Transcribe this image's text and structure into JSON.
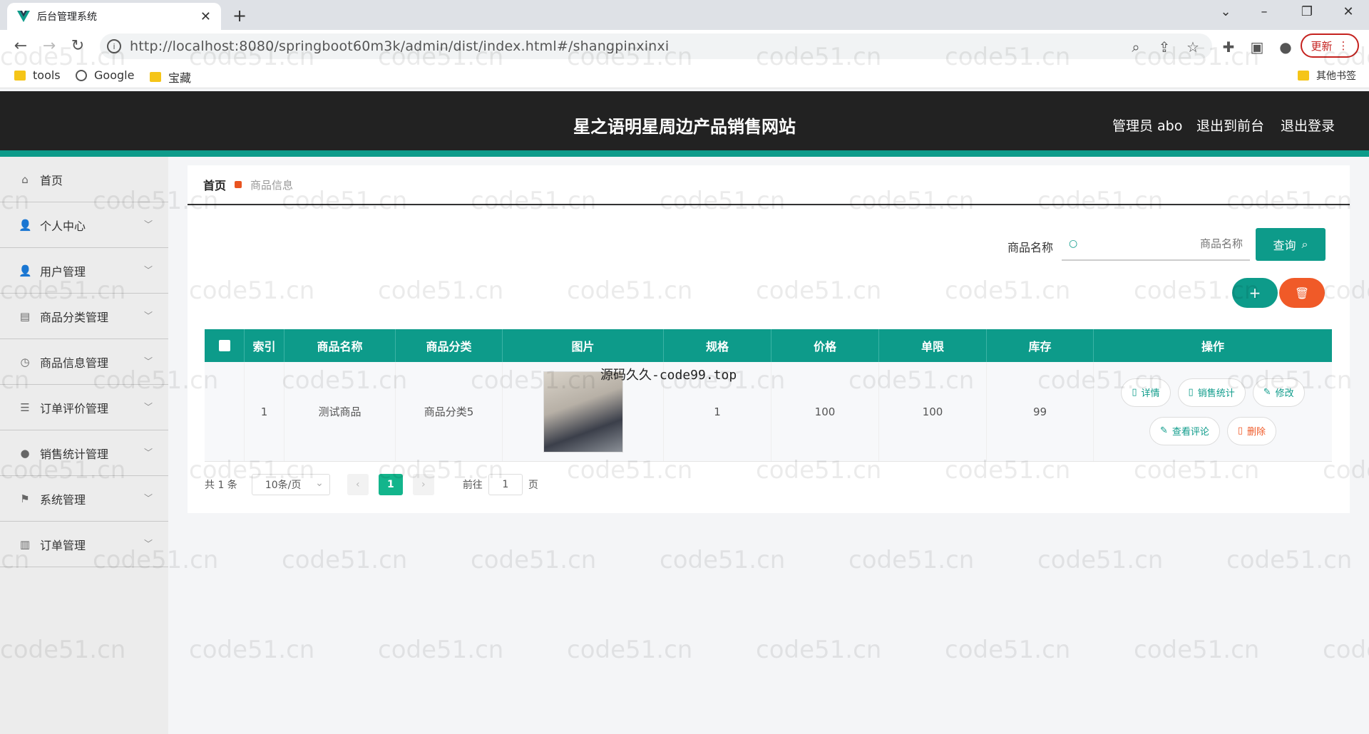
{
  "browser": {
    "tab_title": "后台管理系统",
    "url": "http://localhost:8080/springboot60m3k/admin/dist/index.html#/shangpinxinxi",
    "update_label": "更新",
    "bookmarks": [
      "tools",
      "Google",
      "宝藏"
    ],
    "other_bookmarks": "其他书签"
  },
  "header": {
    "site_title": "星之语明星周边产品销售网站",
    "admin_label": "管理员 abo",
    "to_front_label": "退出到前台",
    "logout_label": "退出登录"
  },
  "sidebar": {
    "items": [
      {
        "label": "首页",
        "icon": "home-icon"
      },
      {
        "label": "个人中心",
        "icon": "user-icon"
      },
      {
        "label": "用户管理",
        "icon": "user-icon"
      },
      {
        "label": "商品分类管理",
        "icon": "briefcase-icon"
      },
      {
        "label": "商品信息管理",
        "icon": "compass-icon"
      },
      {
        "label": "订单评价管理",
        "icon": "list-icon"
      },
      {
        "label": "销售统计管理",
        "icon": "pin-icon"
      },
      {
        "label": "系统管理",
        "icon": "flag-icon"
      },
      {
        "label": "订单管理",
        "icon": "trash-icon"
      }
    ]
  },
  "breadcrumb": {
    "home": "首页",
    "current": "商品信息"
  },
  "search": {
    "label": "商品名称",
    "placeholder": "商品名称",
    "button_label": "查询"
  },
  "table": {
    "columns": [
      "索引",
      "商品名称",
      "商品分类",
      "图片",
      "规格",
      "价格",
      "单限",
      "库存",
      "操作"
    ],
    "rows": [
      {
        "index": "1",
        "name": "测试商品",
        "category": "商品分类5",
        "image_overlay": "源码久久-code99.top",
        "spec": "1",
        "price": "100",
        "limit": "100",
        "stock": "99"
      }
    ],
    "actions": {
      "detail": "详情",
      "sales": "销售统计",
      "edit": "修改",
      "comments": "查看评论",
      "delete": "删除"
    }
  },
  "pager": {
    "total": "共 1 条",
    "page_size": "10条/页",
    "current_page": "1",
    "goto_label": "前往",
    "goto_value": "1",
    "page_suffix": "页"
  },
  "watermark": "code51.cn",
  "colors": {
    "accent": "#0d9b8a",
    "danger": "#f05a28",
    "header_bg": "#222222"
  }
}
